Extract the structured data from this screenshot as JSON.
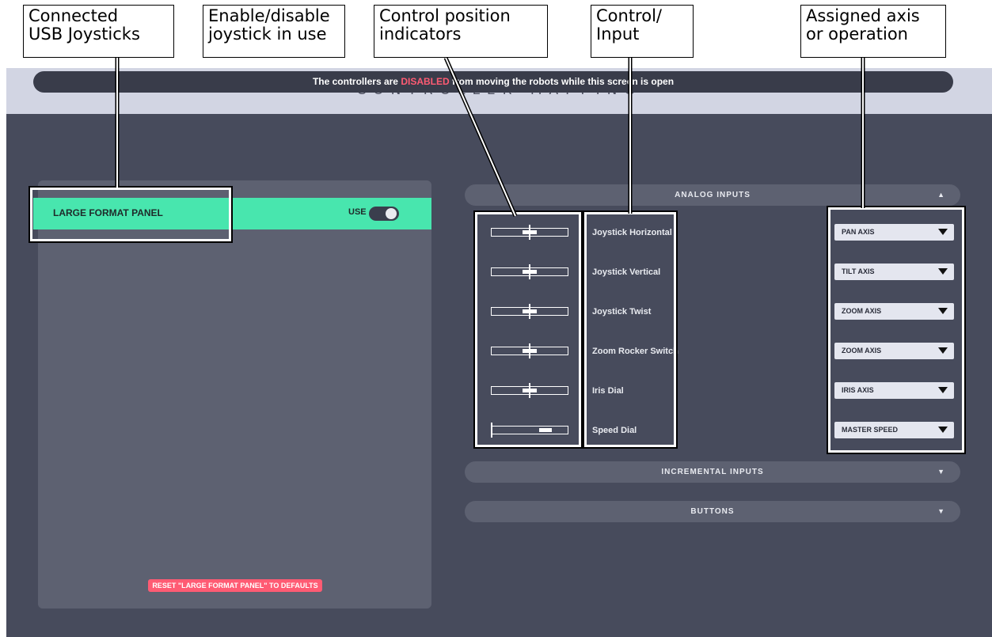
{
  "callouts": {
    "connected": [
      "Connected",
      "USB Joysticks"
    ],
    "enable": [
      "Enable/disable",
      "joystick in use"
    ],
    "indicators": [
      "Control position",
      "indicators"
    ],
    "control": [
      "Control/",
      "Input"
    ],
    "assigned": [
      "Assigned axis",
      "or operation"
    ]
  },
  "app": {
    "title": "CONTROLLER MAPPING",
    "banner": {
      "prefix": "The controllers are ",
      "status": "DISABLED",
      "suffix": " from moving the robots while this screen is open"
    },
    "devices": {
      "name": "LARGE FORMAT PANEL",
      "use_label": "USE",
      "use_enabled": true
    },
    "reset_label": "RESET \"LARGE FORMAT PANEL\" TO DEFAULTS",
    "sections": {
      "analog": "ANALOG INPUTS",
      "incremental": "INCREMENTAL INPUTS",
      "buttons": "BUTTONS"
    },
    "analog_inputs": [
      {
        "label": "Joystick Horizontal",
        "assignment": "PAN AXIS",
        "position": 0.5
      },
      {
        "label": "Joystick Vertical",
        "assignment": "TILT AXIS",
        "position": 0.5
      },
      {
        "label": "Joystick Twist",
        "assignment": "ZOOM AXIS",
        "position": 0.5
      },
      {
        "label": "Zoom Rocker Switch",
        "assignment": "ZOOM AXIS",
        "position": 0.5
      },
      {
        "label": "Iris Dial",
        "assignment": "IRIS AXIS",
        "position": 0.5
      },
      {
        "label": "Speed Dial",
        "assignment": "MASTER SPEED",
        "position": 0.0
      }
    ]
  },
  "colors": {
    "accent_green": "#48e6ae",
    "alert_red": "#ff5b73",
    "background": "#474b5c",
    "panel": "#5d6171"
  }
}
